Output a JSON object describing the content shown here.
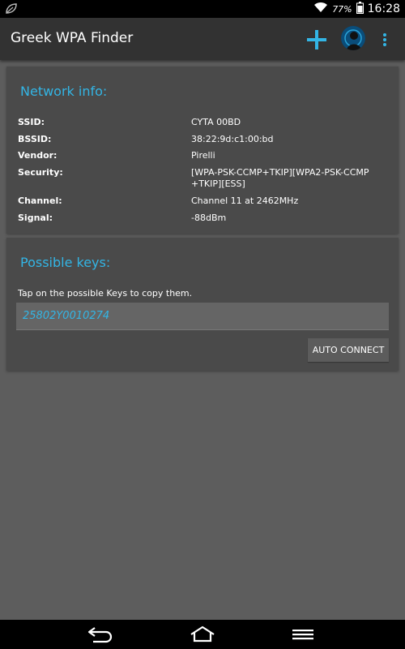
{
  "status_bar": {
    "battery": "77%",
    "time": "16:28",
    "icons": [
      "leaf-notification-icon",
      "wifi-icon",
      "battery-icon"
    ]
  },
  "action_bar": {
    "title": "Greek WPA Finder",
    "icons": [
      "add-icon",
      "avatar-icon",
      "overflow-menu-icon"
    ],
    "accent_color": "#33b5e5"
  },
  "network_info": {
    "title": "Network info:",
    "rows": [
      {
        "label": "SSID:",
        "value": "CYTA 00BD"
      },
      {
        "label": "BSSID:",
        "value": "38:22:9d:c1:00:bd"
      },
      {
        "label": "Vendor:",
        "value": "Pirelli"
      },
      {
        "label": "Security:",
        "value": "[WPA-PSK-CCMP+TKIP][WPA2-PSK-CCMP+TKIP][ESS]"
      },
      {
        "label": "Channel:",
        "value": "Channel 11 at 2462MHz"
      },
      {
        "label": "Signal:",
        "value": "-88dBm"
      }
    ]
  },
  "possible_keys": {
    "title": "Possible keys:",
    "hint": "Tap on the possible Keys to copy them.",
    "keys": [
      "25802Y0010274"
    ],
    "auto_connect_label": "AUTO CONNECT"
  },
  "nav_bar": {
    "icons": [
      "back-icon",
      "home-icon",
      "menu-icon"
    ]
  }
}
